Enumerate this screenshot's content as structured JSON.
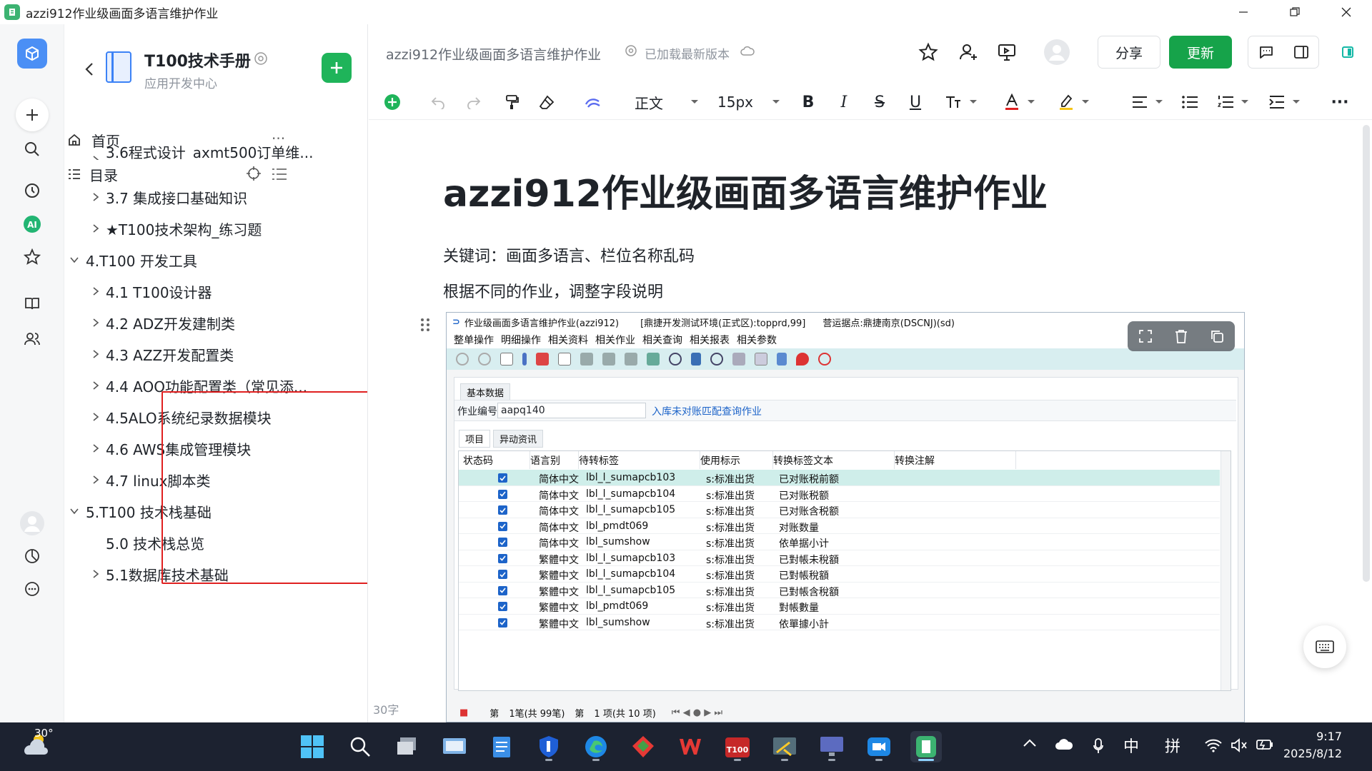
{
  "window": {
    "title": "azzi912作业级画面多语言维护作业"
  },
  "sidebar": {
    "kb_title": "T100技术手册",
    "kb_subtitle": "应用开发中心",
    "home_label": "首页",
    "toc_label": "目录",
    "items": [
      {
        "label": "3.6程式设计_axmt500订单维...",
        "indent": 2,
        "collapsed": true
      },
      {
        "label": "3.7 集成接口基础知识",
        "indent": 2,
        "collapsed": true
      },
      {
        "label": "★T100技术架构_练习题",
        "indent": 2,
        "collapsed": true
      },
      {
        "label": "4.T100 开发工具",
        "indent": 1,
        "collapsed": false
      },
      {
        "label": "4.1 T100设计器",
        "indent": 2,
        "collapsed": true
      },
      {
        "label": "4.2 ADZ开发建制类",
        "indent": 2,
        "collapsed": true
      },
      {
        "label": "4.3 AZZ开发配置类",
        "indent": 2,
        "collapsed": true
      },
      {
        "label": "4.4 AOO功能配置类（常见添...",
        "indent": 2,
        "collapsed": true
      },
      {
        "label": "4.5ALO系统纪录数据模块",
        "indent": 2,
        "collapsed": true
      },
      {
        "label": "4.6 AWS集成管理模块",
        "indent": 2,
        "collapsed": true
      },
      {
        "label": "4.7 linux脚本类",
        "indent": 2,
        "collapsed": true
      },
      {
        "label": "5.T100 技术栈基础",
        "indent": 1,
        "collapsed": false
      },
      {
        "label": "5.0 技术栈总览",
        "indent": 2,
        "collapsed": null
      },
      {
        "label": "5.1数据库技术基础",
        "indent": 2,
        "collapsed": true
      }
    ]
  },
  "header": {
    "doc_title": "azzi912作业级画面多语言维护作业",
    "status": "已加载最新版本",
    "share_label": "分享",
    "update_label": "更新"
  },
  "toolbar": {
    "style": "正文",
    "font_size": "15px"
  },
  "document": {
    "title": "azzi912作业级画面多语言维护作业",
    "paragraphs": [
      "关键词：画面多语言、栏位名称乱码",
      "根据不同的作业，调整字段说明"
    ],
    "word_count": "30字"
  },
  "embedded": {
    "title": "作业级画面多语言维护作业(azzi912)",
    "env": "[鼎捷开发测试环境(正式区):topprd,99]",
    "site": "营运据点:鼎捷南京(DSCNJ)(sd)",
    "menu": [
      "整单操作",
      "明细操作",
      "相关资料",
      "相关作业",
      "相关查询",
      "相关报表",
      "相关参数"
    ],
    "tab_basic": "基本数据",
    "field_label": "作业编号",
    "field_value": "aapq140",
    "field_link": "入库未对账匹配查询作业",
    "tabs": [
      "项目",
      "异动资讯"
    ],
    "columns": [
      "状态码",
      "语言别",
      "待转标签",
      "使用标示",
      "转换标签文本",
      "转换注解"
    ],
    "rows": [
      {
        "lang": "简体中文",
        "tag": "lbl_l_sumapcb103",
        "usage": "s:标准出货",
        "text": "已对账税前额"
      },
      {
        "lang": "简体中文",
        "tag": "lbl_l_sumapcb104",
        "usage": "s:标准出货",
        "text": "已对账税额"
      },
      {
        "lang": "简体中文",
        "tag": "lbl_l_sumapcb105",
        "usage": "s:标准出货",
        "text": "已对账含税额"
      },
      {
        "lang": "简体中文",
        "tag": "lbl_pmdt069",
        "usage": "s:标准出货",
        "text": "对账数量"
      },
      {
        "lang": "简体中文",
        "tag": "lbl_sumshow",
        "usage": "s:标准出货",
        "text": "依单据小计"
      },
      {
        "lang": "繁體中文",
        "tag": "lbl_l_sumapcb103",
        "usage": "s:标准出货",
        "text": "已對帳未稅額"
      },
      {
        "lang": "繁體中文",
        "tag": "lbl_l_sumapcb104",
        "usage": "s:标准出货",
        "text": "已對帳稅額"
      },
      {
        "lang": "繁體中文",
        "tag": "lbl_l_sumapcb105",
        "usage": "s:标准出货",
        "text": "已對帳含稅額"
      },
      {
        "lang": "繁體中文",
        "tag": "lbl_pmdt069",
        "usage": "s:标准出货",
        "text": "對帳數量"
      },
      {
        "lang": "繁體中文",
        "tag": "lbl_sumshow",
        "usage": "s:标准出货",
        "text": "依單據小計"
      }
    ],
    "pager": {
      "page_label": "第",
      "records": "1笔(共 99笔)",
      "page_label2": "第",
      "pages": "1 项(共 10 项)"
    }
  },
  "taskbar": {
    "weather": "30°",
    "ime_lang": "中",
    "ime_mode": "拼",
    "time": "9:17",
    "date": "2025/8/12"
  },
  "colors": {
    "accent_green": "#16a34a",
    "highlight_red": "#e02020",
    "embed_toolbar": "#d8eef0"
  }
}
